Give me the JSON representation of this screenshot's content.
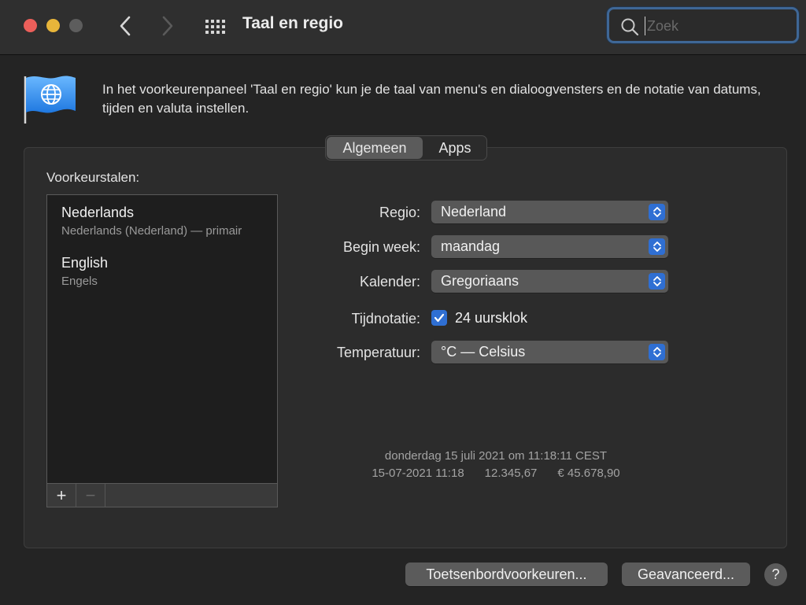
{
  "window": {
    "title": "Taal en regio"
  },
  "search": {
    "placeholder": "Zoek"
  },
  "intro": {
    "text": "In het voorkeurenpaneel 'Taal en regio' kun je de taal van menu's en dialoogvensters en de notatie van datums, tijden en valuta instellen."
  },
  "tabs": [
    {
      "label": "Algemeen",
      "selected": true
    },
    {
      "label": "Apps",
      "selected": false
    }
  ],
  "languages": {
    "heading": "Voorkeurstalen:",
    "items": [
      {
        "name": "Nederlands",
        "detail": "Nederlands (Nederland) — primair"
      },
      {
        "name": "English",
        "detail": "Engels"
      }
    ],
    "add_label": "+",
    "remove_label": "−"
  },
  "form": {
    "region": {
      "label": "Regio:",
      "value": "Nederland"
    },
    "week_start": {
      "label": "Begin week:",
      "value": "maandag"
    },
    "calendar": {
      "label": "Kalender:",
      "value": "Gregoriaans"
    },
    "time_format": {
      "label": "Tijdnotatie:",
      "checkbox_label": "24 uursklok",
      "checked": true
    },
    "temperature": {
      "label": "Temperatuur:",
      "value": "°C — Celsius"
    }
  },
  "sample": {
    "long_date": "donderdag 15 juli 2021 om 11:18:11 CEST",
    "short_date": "15-07-2021 11:18",
    "number": "12.345,67",
    "currency": "€ 45.678,90"
  },
  "buttons": {
    "keyboard": "Toetsenbordvoorkeuren...",
    "advanced": "Geavanceerd...",
    "help": "?"
  },
  "colors": {
    "accent": "#2f6fd3",
    "close": "#ec5f5a",
    "minimize": "#e8b53a",
    "zoom_disabled": "#5d5d5d"
  }
}
